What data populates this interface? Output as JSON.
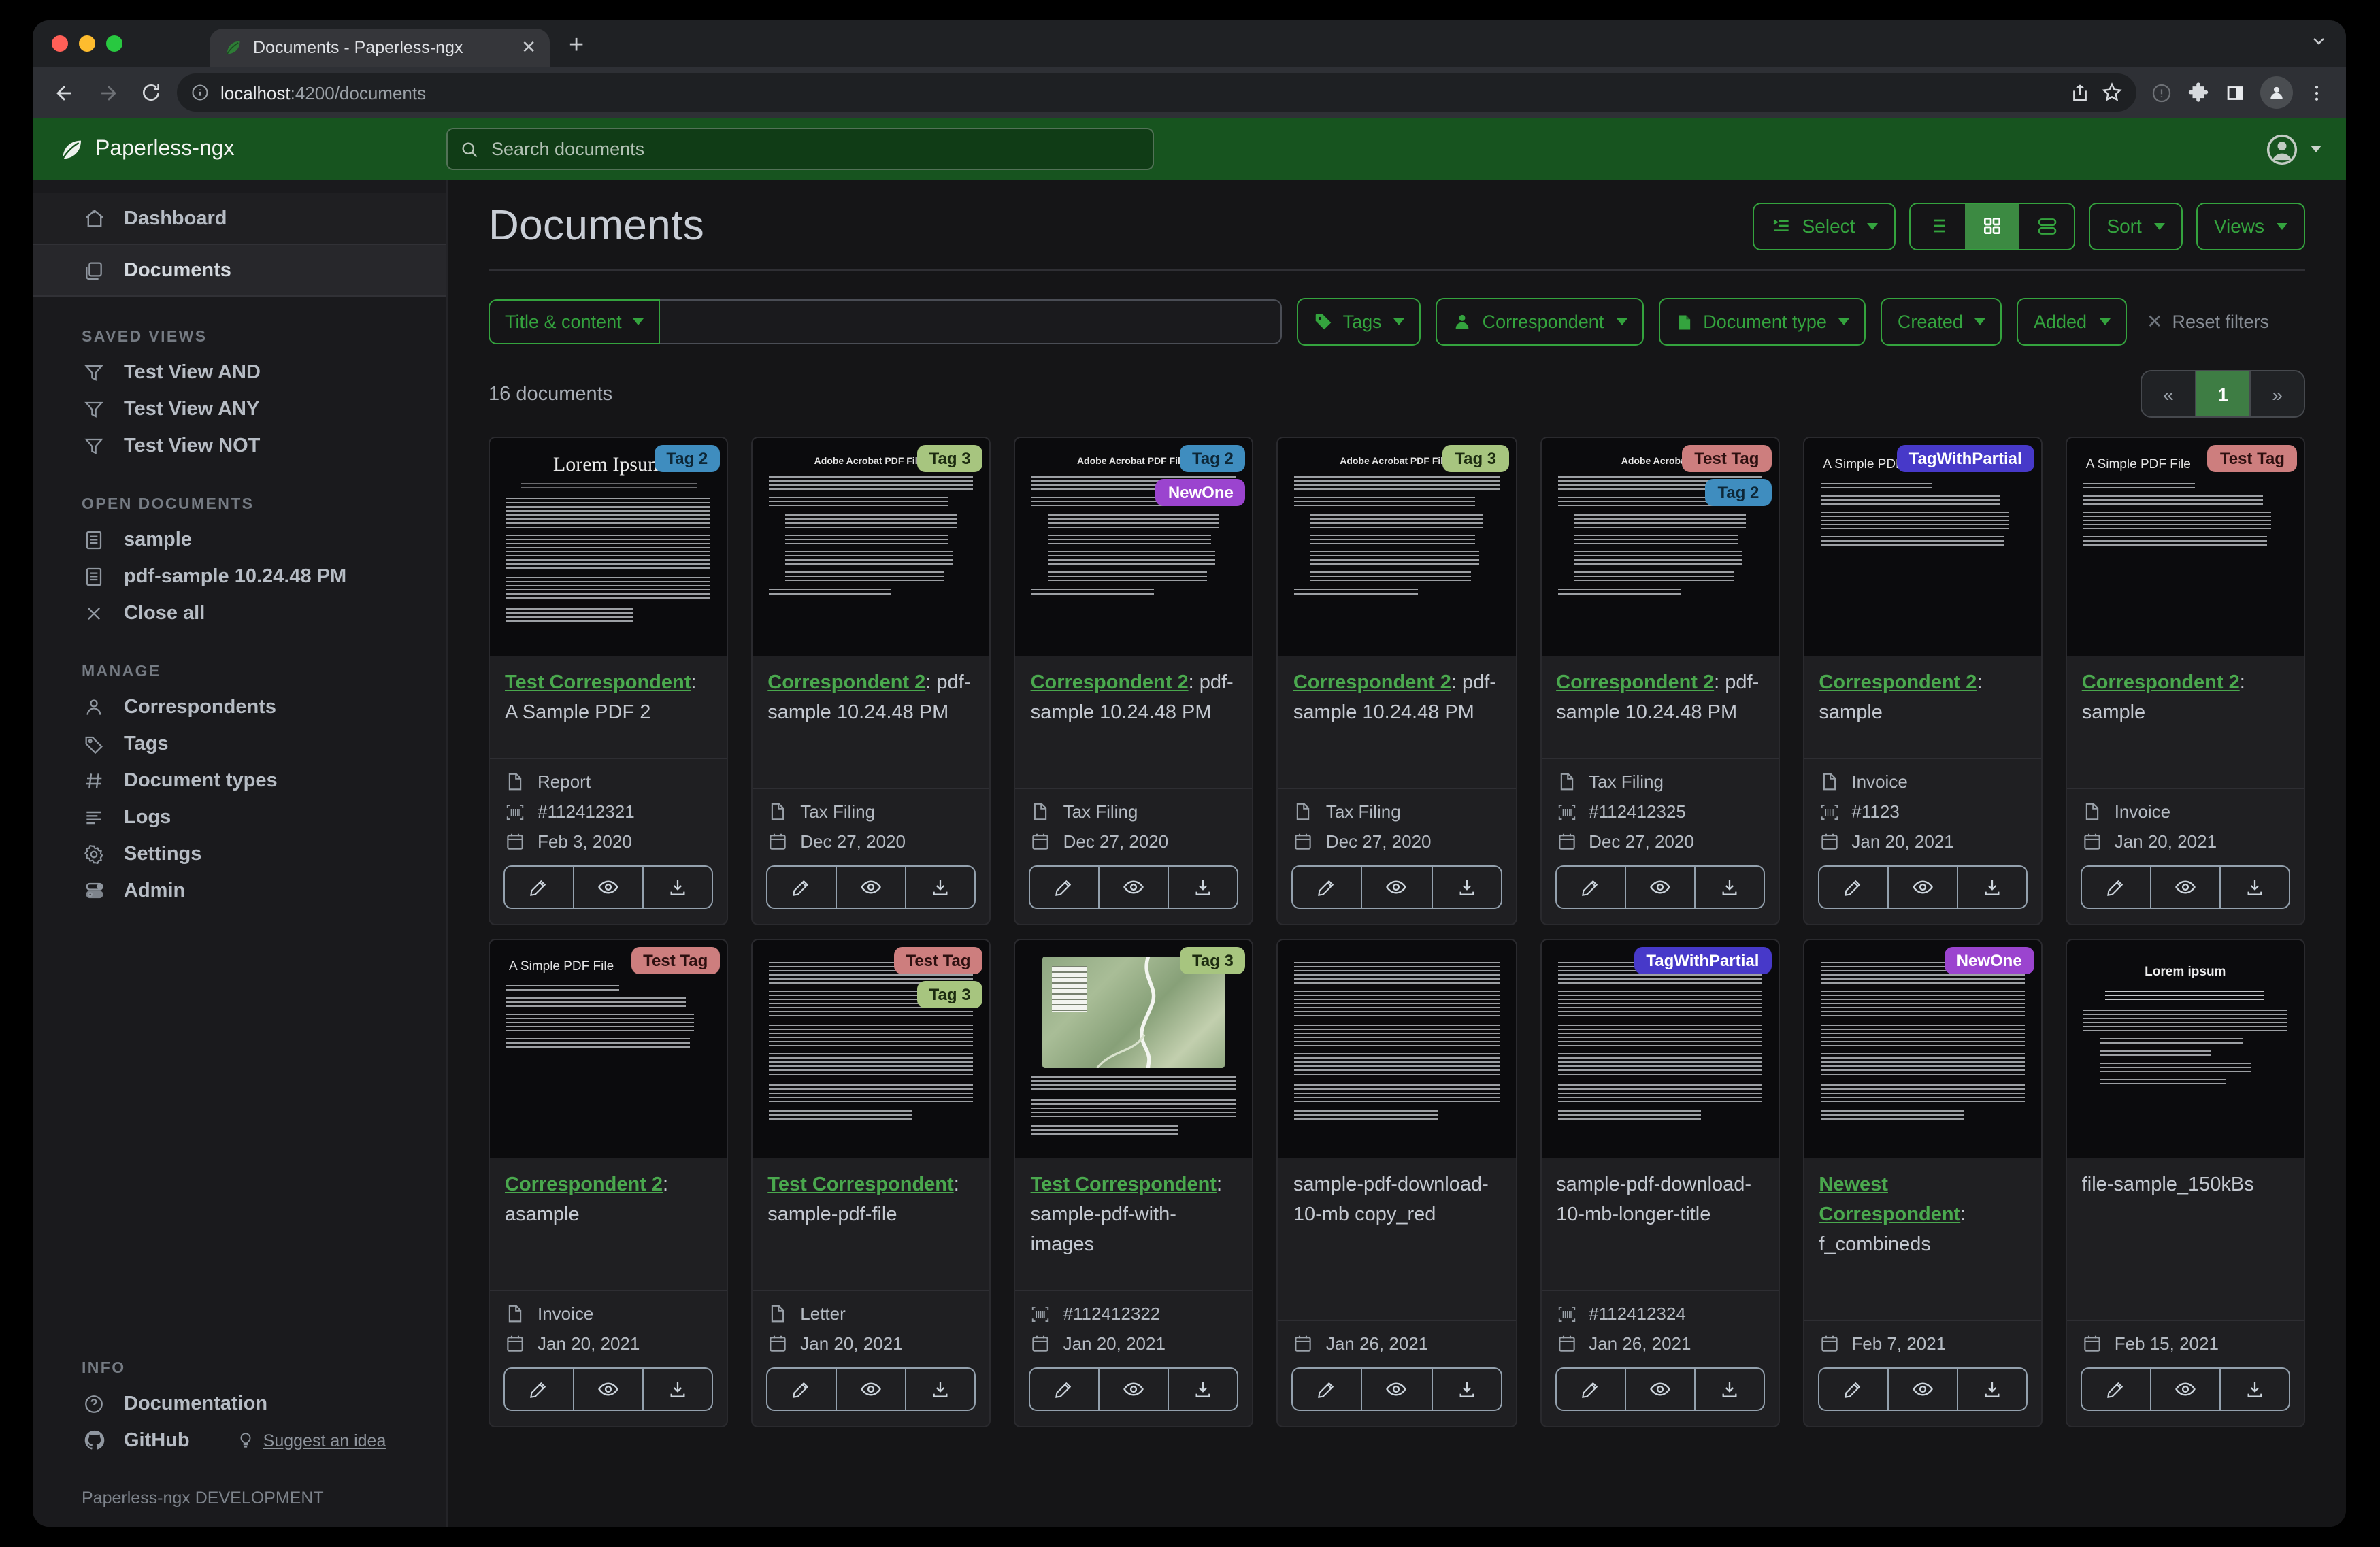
{
  "browser": {
    "tab_title": "Documents - Paperless-ngx",
    "close_tab": "✕",
    "new_tab": "+",
    "url_host": "localhost",
    "url_rest": ":4200/documents"
  },
  "navbar": {
    "brand": "Paperless-ngx",
    "search_placeholder": "Search documents"
  },
  "sidebar": {
    "primary": [
      {
        "label": "Dashboard",
        "icon": "home",
        "active": false
      },
      {
        "label": "Documents",
        "icon": "documents",
        "active": true
      }
    ],
    "sections": [
      {
        "title": "SAVED VIEWS",
        "items": [
          {
            "label": "Test View AND",
            "icon": "funnel"
          },
          {
            "label": "Test View ANY",
            "icon": "funnel"
          },
          {
            "label": "Test View NOT",
            "icon": "funnel"
          }
        ]
      },
      {
        "title": "OPEN DOCUMENTS",
        "items": [
          {
            "label": "sample",
            "icon": "filetext"
          },
          {
            "label": "pdf-sample 10.24.48 PM",
            "icon": "filetext"
          },
          {
            "label": "Close all",
            "icon": "close"
          }
        ]
      },
      {
        "title": "MANAGE",
        "items": [
          {
            "label": "Correspondents",
            "icon": "person"
          },
          {
            "label": "Tags",
            "icon": "tag"
          },
          {
            "label": "Document types",
            "icon": "hash"
          },
          {
            "label": "Logs",
            "icon": "logs"
          },
          {
            "label": "Settings",
            "icon": "gear"
          },
          {
            "label": "Admin",
            "icon": "admin"
          }
        ]
      },
      {
        "title": "INFO",
        "items": [
          {
            "label": "Documentation",
            "icon": "question"
          },
          {
            "label": "GitHub",
            "icon": "github",
            "extra": "Suggest an idea",
            "extra_icon": "bulb"
          }
        ]
      }
    ],
    "footer": "Paperless-ngx DEVELOPMENT"
  },
  "page": {
    "title": "Documents",
    "select_label": "Select",
    "sort_label": "Sort",
    "views_label": "Views",
    "count": "16 documents",
    "pagination": {
      "prev": "«",
      "page": "1",
      "next": "»"
    }
  },
  "filters": {
    "field_label": "Title & content",
    "input_value": "",
    "tags_label": "Tags",
    "correspondent_label": "Correspondent",
    "doctype_label": "Document type",
    "created_label": "Created",
    "added_label": "Added",
    "reset_label": "Reset filters"
  },
  "tag_colors": {
    "Tag 2": {
      "bg": "#3f8dbf",
      "fg": "#0d2737"
    },
    "Tag 3": {
      "bg": "#a7c57f",
      "fg": "#1c2b10"
    },
    "NewOne": {
      "bg": "#9b44cf",
      "fg": "#ffffff"
    },
    "Test Tag": {
      "bg": "#cd7e7e",
      "fg": "#2d1010"
    },
    "TagWithPartial": {
      "bg": "#4739c9",
      "fg": "#ffffff"
    }
  },
  "accent_green": "#34a33e",
  "documents": [
    {
      "correspondent": "Test Correspondent",
      "title": "A Sample PDF 2",
      "tags": [
        "Tag 2"
      ],
      "type": "Report",
      "asn": "#112412321",
      "date": "Feb 3, 2020",
      "thumb": {
        "variant": "lorem_serif",
        "heading": "Lorem Ipsum"
      }
    },
    {
      "correspondent": "Correspondent 2",
      "title": "pdf-sample 10.24.48 PM",
      "tags": [
        "Tag 3"
      ],
      "type": "Tax Filing",
      "asn": null,
      "date": "Dec 27, 2020",
      "thumb": {
        "variant": "adobe",
        "heading": "Adobe Acrobat PDF Files"
      }
    },
    {
      "correspondent": "Correspondent 2",
      "title": "pdf-sample 10.24.48 PM",
      "tags": [
        "Tag 2",
        "NewOne"
      ],
      "type": "Tax Filing",
      "asn": null,
      "date": "Dec 27, 2020",
      "thumb": {
        "variant": "adobe",
        "heading": "Adobe Acrobat PDF Files"
      }
    },
    {
      "correspondent": "Correspondent 2",
      "title": "pdf-sample 10.24.48 PM",
      "tags": [
        "Tag 3"
      ],
      "type": "Tax Filing",
      "asn": null,
      "date": "Dec 27, 2020",
      "thumb": {
        "variant": "adobe",
        "heading": "Adobe Acrobat PDF Files"
      }
    },
    {
      "correspondent": "Correspondent 2",
      "title": "pdf-sample 10.24.48 PM",
      "tags": [
        "Test Tag",
        "Tag 2"
      ],
      "type": "Tax Filing",
      "asn": "#112412325",
      "date": "Dec 27, 2020",
      "thumb": {
        "variant": "adobe",
        "heading": "Adobe Acrobat P"
      }
    },
    {
      "correspondent": "Correspondent 2",
      "title": "sample",
      "tags": [
        "TagWithPartial"
      ],
      "type": "Invoice",
      "asn": "#1123",
      "date": "Jan 20, 2021",
      "thumb": {
        "variant": "simple",
        "heading": "A Simple PDF File"
      }
    },
    {
      "correspondent": "Correspondent 2",
      "title": "sample",
      "tags": [
        "Test Tag"
      ],
      "type": "Invoice",
      "asn": null,
      "date": "Jan 20, 2021",
      "thumb": {
        "variant": "simple",
        "heading": "A Simple PDF File"
      }
    },
    {
      "correspondent": "Correspondent 2",
      "title": "asample",
      "tags": [
        "Test Tag"
      ],
      "type": "Invoice",
      "asn": null,
      "date": "Jan 20, 2021",
      "thumb": {
        "variant": "simple",
        "heading": "A Simple PDF File"
      }
    },
    {
      "correspondent": "Test Correspondent",
      "title": "sample-pdf-file",
      "tags": [
        "Test Tag",
        "Tag 3"
      ],
      "type": "Letter",
      "asn": null,
      "date": "Jan 20, 2021",
      "thumb": {
        "variant": "dense",
        "heading": ""
      }
    },
    {
      "correspondent": "Test Correspondent",
      "title": "sample-pdf-with-images",
      "tags": [
        "Tag 3"
      ],
      "type": null,
      "asn": "#112412322",
      "date": "Jan 20, 2021",
      "thumb": {
        "variant": "map",
        "heading": ""
      }
    },
    {
      "correspondent": null,
      "title": "sample-pdf-download-10-mb copy_red",
      "tags": [],
      "type": null,
      "asn": null,
      "date": "Jan 26, 2021",
      "thumb": {
        "variant": "dense",
        "heading": ""
      }
    },
    {
      "correspondent": null,
      "title": "sample-pdf-download-10-mb-longer-title",
      "tags": [
        "TagWithPartial"
      ],
      "type": null,
      "asn": "#112412324",
      "date": "Jan 26, 2021",
      "thumb": {
        "variant": "dense",
        "heading": ""
      }
    },
    {
      "correspondent": "Newest Correspondent",
      "title": "f_combineds",
      "tags": [
        "NewOne"
      ],
      "type": null,
      "asn": null,
      "date": "Feb 7, 2021",
      "thumb": {
        "variant": "dense",
        "heading": ""
      }
    },
    {
      "correspondent": null,
      "title": "file-sample_150kBs",
      "tags": [],
      "type": null,
      "asn": null,
      "date": "Feb 15, 2021",
      "thumb": {
        "variant": "article",
        "heading": "Lorem ipsum"
      }
    }
  ]
}
